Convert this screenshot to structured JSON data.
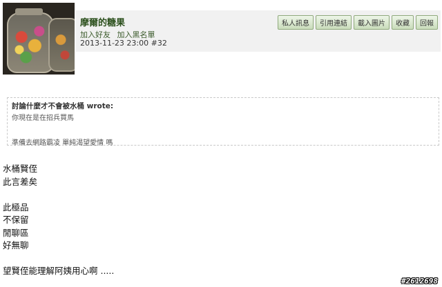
{
  "post": {
    "username": "摩爾的糖果",
    "links": [
      "加入好友",
      "加入黑名單"
    ],
    "date": "2013-11-23 23:00",
    "post_number": "#32",
    "buttons": [
      "私人訊息",
      "引用連結",
      "載入圖片",
      "收藏",
      "回報"
    ]
  },
  "quote": {
    "header": "討論什麼才不會被水桶 wrote:",
    "line1": "你現在是在招兵買馬",
    "line2": "準備去網路霸凌 單純渴望愛情 嗎"
  },
  "body": {
    "lines": [
      "水桶賢侄",
      "此言差矣",
      "",
      "此極品",
      "不保留",
      "閒聊區",
      "好無聊",
      "",
      "望賢侄能理解阿姨用心啊 ....."
    ]
  },
  "watermark": "#2612698"
}
